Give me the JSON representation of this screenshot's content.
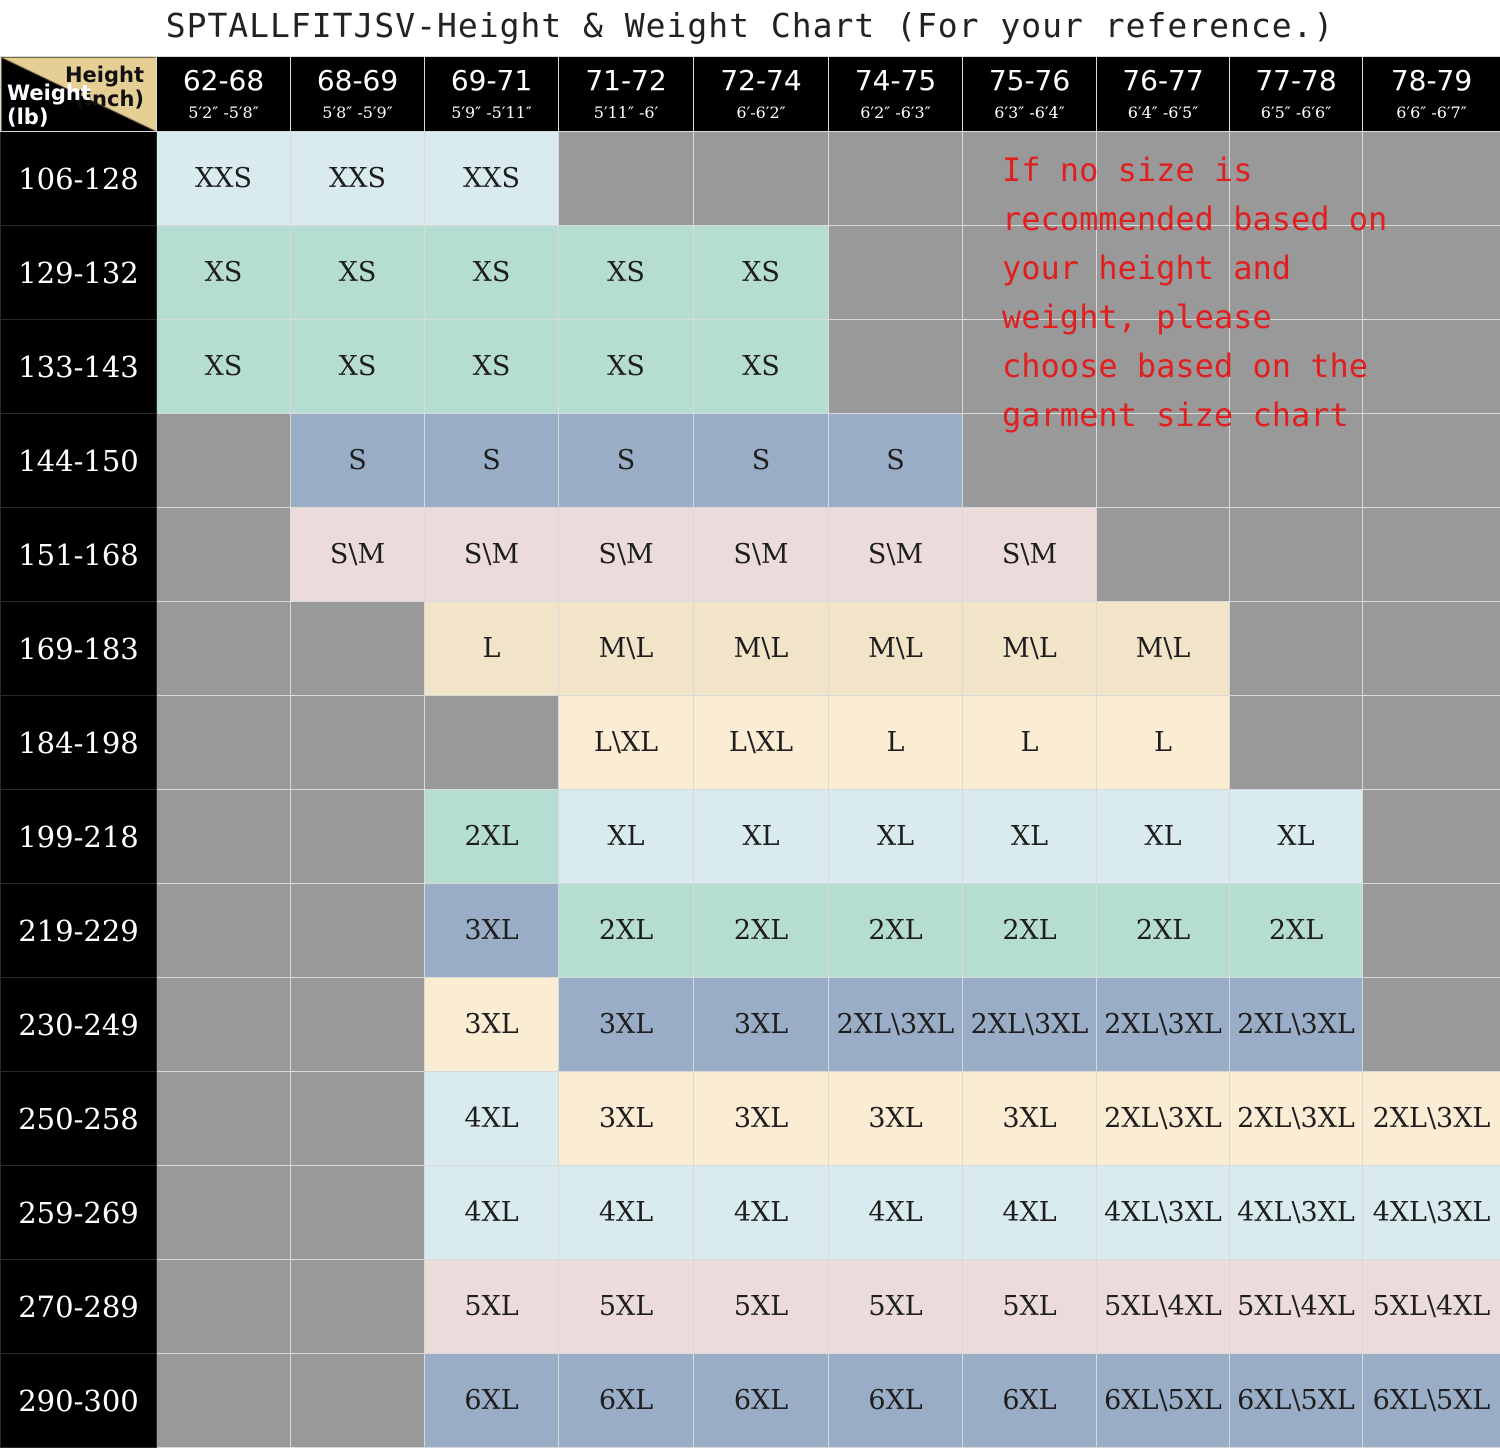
{
  "title": "SPTALLFITJSV-Height & Weight Chart (For your reference.)",
  "corner": {
    "height_label": "Height",
    "inch_label": "(inch)",
    "weight_label": "Weight",
    "lb_label": "(lb)"
  },
  "note": "If no size is recommended based on your height and weight, please choose based on the garment size chart",
  "colors": {
    "XXS": "#d9ebee",
    "XS": "#b5ddd2",
    "S": "#9aadc6",
    "S\\M": "#ecdbdb",
    "L_row169": "#f2e4c8",
    "M\\L": "#f2e4c8",
    "L\\XL": "#fbedd3",
    "L": "#fbedd3",
    "XL": "#d9ebee",
    "2XL": "#b5ddd2",
    "3XL": "#9aadc6",
    "2XL\\3XL": "#9aadc6",
    "4XL": "#d9ebee",
    "5XL": "#ecdbdb",
    "6XL": "#9aadc6",
    "empty": "#999999"
  },
  "chart_data": {
    "type": "table",
    "title": "SPTALLFITJSV-Height & Weight Chart (For your reference.)",
    "columns": [
      {
        "inch": "62-68",
        "ft": "5′2″ -5′8″"
      },
      {
        "inch": "68-69",
        "ft": "5′8″ -5′9″"
      },
      {
        "inch": "69-71",
        "ft": "5′9″ -5′11″"
      },
      {
        "inch": "71-72",
        "ft": "5′11″ -6′"
      },
      {
        "inch": "72-74",
        "ft": "6′-6′2″"
      },
      {
        "inch": "74-75",
        "ft": "6′2″ -6′3″"
      },
      {
        "inch": "75-76",
        "ft": "6′3″ -6′4″"
      },
      {
        "inch": "76-77",
        "ft": "6′4″ -6′5″"
      },
      {
        "inch": "77-78",
        "ft": "6′5″ -6′6″"
      },
      {
        "inch": "78-79",
        "ft": "6′6″ -6′7″"
      }
    ],
    "rows": [
      {
        "weight": "106-128",
        "sizes": [
          "XXS",
          "XXS",
          "XXS",
          "",
          "",
          "",
          "",
          "",
          "",
          ""
        ]
      },
      {
        "weight": "129-132",
        "sizes": [
          "XS",
          "XS",
          "XS",
          "XS",
          "XS",
          "",
          "",
          "",
          "",
          ""
        ]
      },
      {
        "weight": "133-143",
        "sizes": [
          "XS",
          "XS",
          "XS",
          "XS",
          "XS",
          "",
          "",
          "",
          "",
          ""
        ]
      },
      {
        "weight": "144-150",
        "sizes": [
          "",
          "S",
          "S",
          "S",
          "S",
          "S",
          "",
          "",
          "",
          ""
        ]
      },
      {
        "weight": "151-168",
        "sizes": [
          "",
          "S\\M",
          "S\\M",
          "S\\M",
          "S\\M",
          "S\\M",
          "S\\M",
          "",
          "",
          ""
        ]
      },
      {
        "weight": "169-183",
        "sizes": [
          "",
          "",
          "L",
          "M\\L",
          "M\\L",
          "M\\L",
          "M\\L",
          "M\\L",
          "",
          ""
        ]
      },
      {
        "weight": "184-198",
        "sizes": [
          "",
          "",
          "",
          "L\\XL",
          "L\\XL",
          "L",
          "L",
          "L",
          "",
          ""
        ]
      },
      {
        "weight": "199-218",
        "sizes": [
          "",
          "",
          "2XL",
          "XL",
          "XL",
          "XL",
          "XL",
          "XL",
          "XL",
          ""
        ]
      },
      {
        "weight": "219-229",
        "sizes": [
          "",
          "",
          "3XL",
          "2XL",
          "2XL",
          "2XL",
          "2XL",
          "2XL",
          "2XL",
          ""
        ]
      },
      {
        "weight": "230-249",
        "sizes": [
          "",
          "",
          "3XL",
          "3XL",
          "3XL",
          "2XL\\3XL",
          "2XL\\3XL",
          "2XL\\3XL",
          "2XL\\3XL",
          ""
        ]
      },
      {
        "weight": "250-258",
        "sizes": [
          "",
          "",
          "4XL",
          "3XL",
          "3XL",
          "3XL",
          "3XL",
          "2XL\\3XL",
          "2XL\\3XL",
          "2XL\\3XL"
        ]
      },
      {
        "weight": "259-269",
        "sizes": [
          "",
          "",
          "4XL",
          "4XL",
          "4XL",
          "4XL",
          "4XL",
          "4XL\\3XL",
          "4XL\\3XL",
          "4XL\\3XL"
        ]
      },
      {
        "weight": "270-289",
        "sizes": [
          "",
          "",
          "5XL",
          "5XL",
          "5XL",
          "5XL",
          "5XL",
          "5XL\\4XL",
          "5XL\\4XL",
          "5XL\\4XL"
        ]
      },
      {
        "weight": "290-300",
        "sizes": [
          "",
          "",
          "6XL",
          "6XL",
          "6XL",
          "6XL",
          "6XL",
          "6XL\\5XL",
          "6XL\\5XL",
          "6XL\\5XL"
        ]
      }
    ],
    "cell_colors": [
      [
        "#d9ebee",
        "#d9ebee",
        "#d9ebee",
        "",
        "",
        "",
        "",
        "",
        "",
        ""
      ],
      [
        "#b5ddd2",
        "#b5ddd2",
        "#b5ddd2",
        "#b5ddd2",
        "#b5ddd2",
        "",
        "",
        "",
        "",
        ""
      ],
      [
        "#b5ddd2",
        "#b5ddd2",
        "#b5ddd2",
        "#b5ddd2",
        "#b5ddd2",
        "",
        "",
        "",
        "",
        ""
      ],
      [
        "",
        "#9aadc6",
        "#9aadc6",
        "#9aadc6",
        "#9aadc6",
        "#9aadc6",
        "",
        "",
        "",
        ""
      ],
      [
        "",
        "#ecdbdb",
        "#ecdbdb",
        "#ecdbdb",
        "#ecdbdb",
        "#ecdbdb",
        "#ecdbdb",
        "",
        "",
        ""
      ],
      [
        "",
        "",
        "#f2e4c8",
        "#f2e4c8",
        "#f2e4c8",
        "#f2e4c8",
        "#f2e4c8",
        "#f2e4c8",
        "",
        ""
      ],
      [
        "",
        "",
        "",
        "#fbedd3",
        "#fbedd3",
        "#fbedd3",
        "#fbedd3",
        "#fbedd3",
        "",
        ""
      ],
      [
        "",
        "",
        "#b5ddd2",
        "#d9ebee",
        "#d9ebee",
        "#d9ebee",
        "#d9ebee",
        "#d9ebee",
        "#d9ebee",
        ""
      ],
      [
        "",
        "",
        "#9aadc6",
        "#b5ddd2",
        "#b5ddd2",
        "#b5ddd2",
        "#b5ddd2",
        "#b5ddd2",
        "#b5ddd2",
        ""
      ],
      [
        "",
        "",
        "#fbedd3",
        "#9aadc6",
        "#9aadc6",
        "#9aadc6",
        "#9aadc6",
        "#9aadc6",
        "#9aadc6",
        ""
      ],
      [
        "",
        "",
        "#d9ebee",
        "#fbedd3",
        "#fbedd3",
        "#fbedd3",
        "#fbedd3",
        "#fbedd3",
        "#fbedd3",
        "#fbedd3"
      ],
      [
        "",
        "",
        "#d9ebee",
        "#d9ebee",
        "#d9ebee",
        "#d9ebee",
        "#d9ebee",
        "#d9ebee",
        "#d9ebee",
        "#d9ebee"
      ],
      [
        "",
        "",
        "#ecdbdb",
        "#ecdbdb",
        "#ecdbdb",
        "#ecdbdb",
        "#ecdbdb",
        "#ecdbdb",
        "#ecdbdb",
        "#ecdbdb"
      ],
      [
        "",
        "",
        "#9aadc6",
        "#9aadc6",
        "#9aadc6",
        "#9aadc6",
        "#9aadc6",
        "#9aadc6",
        "#9aadc6",
        "#9aadc6"
      ]
    ]
  }
}
